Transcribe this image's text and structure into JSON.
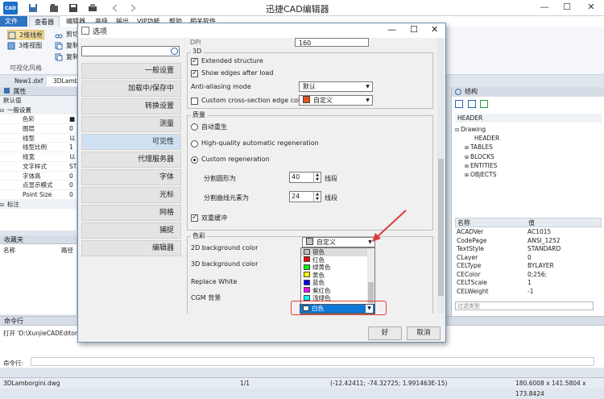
{
  "app": {
    "logo_text": "CAD",
    "title": "迅捷CAD编辑器",
    "win_controls": [
      "—",
      "☐",
      "✕"
    ]
  },
  "ribbon": {
    "tabs": [
      "文件",
      "查看器",
      "编辑器",
      "高级",
      "输出",
      "VIP功能",
      "帮助",
      "相关软件"
    ],
    "buttons": [
      "2维线框",
      "3维视图",
      "剪切",
      "复制",
      "复制"
    ],
    "group_label": "可视化风格"
  },
  "doc_tabs": [
    "New1.dxf",
    "3DLambor"
  ],
  "properties": {
    "title": "属性",
    "default_label": "默认值",
    "rows": [
      {
        "name": "一般设置",
        "value": "",
        "header": true
      },
      {
        "name": "色彩",
        "value": "■"
      },
      {
        "name": "图层",
        "value": "0"
      },
      {
        "name": "线型",
        "value": "以"
      },
      {
        "name": "线型比例",
        "value": "1"
      },
      {
        "name": "线宽",
        "value": "以"
      },
      {
        "name": "文字样式",
        "value": "ST"
      },
      {
        "name": "字体高",
        "value": "0"
      },
      {
        "name": "点显示模式",
        "value": "0"
      },
      {
        "name": "Point Size",
        "value": "0"
      },
      {
        "name": "标注",
        "value": "",
        "header": true
      }
    ]
  },
  "favorites": {
    "title": "收藏夹",
    "col_name": "名称",
    "col_path": "路径"
  },
  "command": {
    "title": "命令行",
    "log": "打开 'D:\\XunjieCADEditor\\CAD",
    "prompt": "命令行:"
  },
  "statusbar": {
    "file": "3DLamborgini.dwg",
    "pages": "1/1",
    "coords": "(-12.42411; -74.32725; 1.991463E-15)",
    "size": "180.6008 x 141.5804 x 173.8424"
  },
  "structure": {
    "title": "结构",
    "header_label": "HEADER",
    "tree": [
      "Drawing",
      "HEADER",
      "TABLES",
      "BLOCKS",
      "ENTITIES",
      "OBJECTS"
    ],
    "vars_header": [
      "名称",
      "值"
    ],
    "vars": [
      [
        "ACADVer",
        "AC1015"
      ],
      [
        "CodePage",
        "ANSI_1252"
      ],
      [
        "TextStyle",
        "STANDARD"
      ],
      [
        "CLayer",
        "0"
      ],
      [
        "CELType",
        "BYLAYER"
      ],
      [
        "CEColor",
        "0;256;"
      ],
      [
        "CELTScale",
        "1"
      ],
      [
        "CELWeight",
        "-1"
      ]
    ],
    "filter_placeholder": "过滤类型"
  },
  "dialog": {
    "title": "选项",
    "nav": [
      "一般设置",
      "加载中/保存中",
      "转换设置",
      "测量",
      "可见性",
      "代理服务器",
      "字体",
      "光标",
      "网格",
      "捕捉",
      "编辑器"
    ],
    "active_nav": "可见性",
    "top_dpi_label": "DPI",
    "top_dpi_value": "160",
    "group_3d": {
      "title": "3D",
      "extended": "Extended structure",
      "show_edges": "Show edges after load",
      "aa_label": "Anti-aliasing mode",
      "aa_value": "默认",
      "custom_edge": "Custom cross-section edge color",
      "custom_edge_value": "自定义",
      "custom_edge_color": "#e8511a"
    },
    "group_quality": {
      "title": "质量",
      "auto_regen": "自动重生",
      "hq_regen": "High-quality automatic regeneration",
      "custom_regen": "Custom regeneration",
      "circle_label": "分割圆形为",
      "circle_value": "40",
      "circle_unit": "线段",
      "spline_label": "分割曲线元素为",
      "spline_value": "24",
      "spline_unit": "线段",
      "double_buffer": "双重缓冲"
    },
    "group_color": {
      "title": "色彩",
      "bg2d_label": "2D background color",
      "bg2d_value": "自定义",
      "bg3d_label": "3D background color",
      "replace_white": "Replace White",
      "cgm_label": "CGM 背景"
    },
    "color_options": [
      {
        "label": "银色",
        "color": "#c0c0c0"
      },
      {
        "label": "红色",
        "color": "#ff0000"
      },
      {
        "label": "绿黄色",
        "color": "#00ff00"
      },
      {
        "label": "黄色",
        "color": "#ffff00"
      },
      {
        "label": "蓝色",
        "color": "#0000ff"
      },
      {
        "label": "紫红色",
        "color": "#ff00ff"
      },
      {
        "label": "浅绿色",
        "color": "#00ffff"
      }
    ],
    "selected_color": {
      "label": "白色",
      "color": "#ffffff"
    },
    "ok": "好",
    "cancel": "取消"
  }
}
